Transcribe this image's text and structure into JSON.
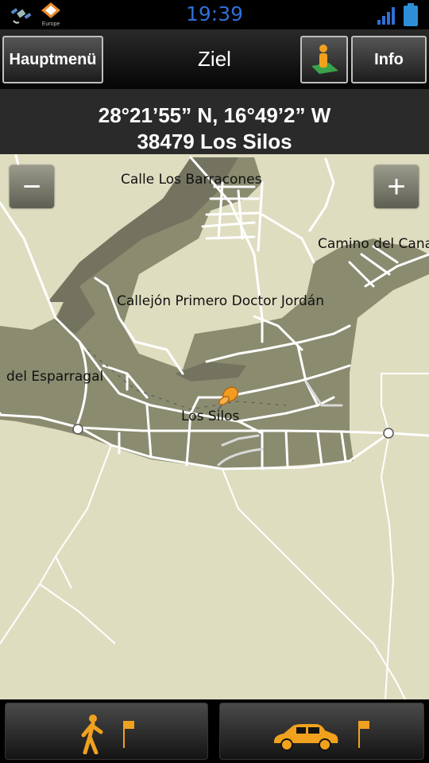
{
  "status": {
    "time": "19:39",
    "left_icons": [
      "gps-satellite-icon",
      "navigator-europe-icon"
    ],
    "europe_caption": "Europe",
    "right_icons": [
      "signal-icon",
      "battery-icon"
    ]
  },
  "toolbar": {
    "main_menu_label": "Hauptmenü",
    "title": "Ziel",
    "info_label": "Info",
    "pedestrian_view_icon": "person-on-map-icon"
  },
  "location": {
    "coordinates": "28°21’55” N, 16°49’2” W",
    "address": "38479 Los Silos"
  },
  "map": {
    "zoom_out_label": "−",
    "zoom_in_label": "+",
    "street_labels": {
      "calle_los_barracones": "Calle Los Barracones",
      "camino_del_canal": "Camino del Cana",
      "callejon": "Callejón Primero Doctor Jordán",
      "del_esparragal": "del Esparragal",
      "los_silos": "Los Silos"
    },
    "colors": {
      "background": "#dfddc0",
      "urban_area": "#8b8b70",
      "roads": "#ffffff"
    },
    "marker_icon": "orange-pushpin-icon"
  },
  "bottom": {
    "walk_button_icon": "walking-person-icon",
    "car_button_icon": "car-icon",
    "flag_icon": "destination-flag-icon"
  }
}
